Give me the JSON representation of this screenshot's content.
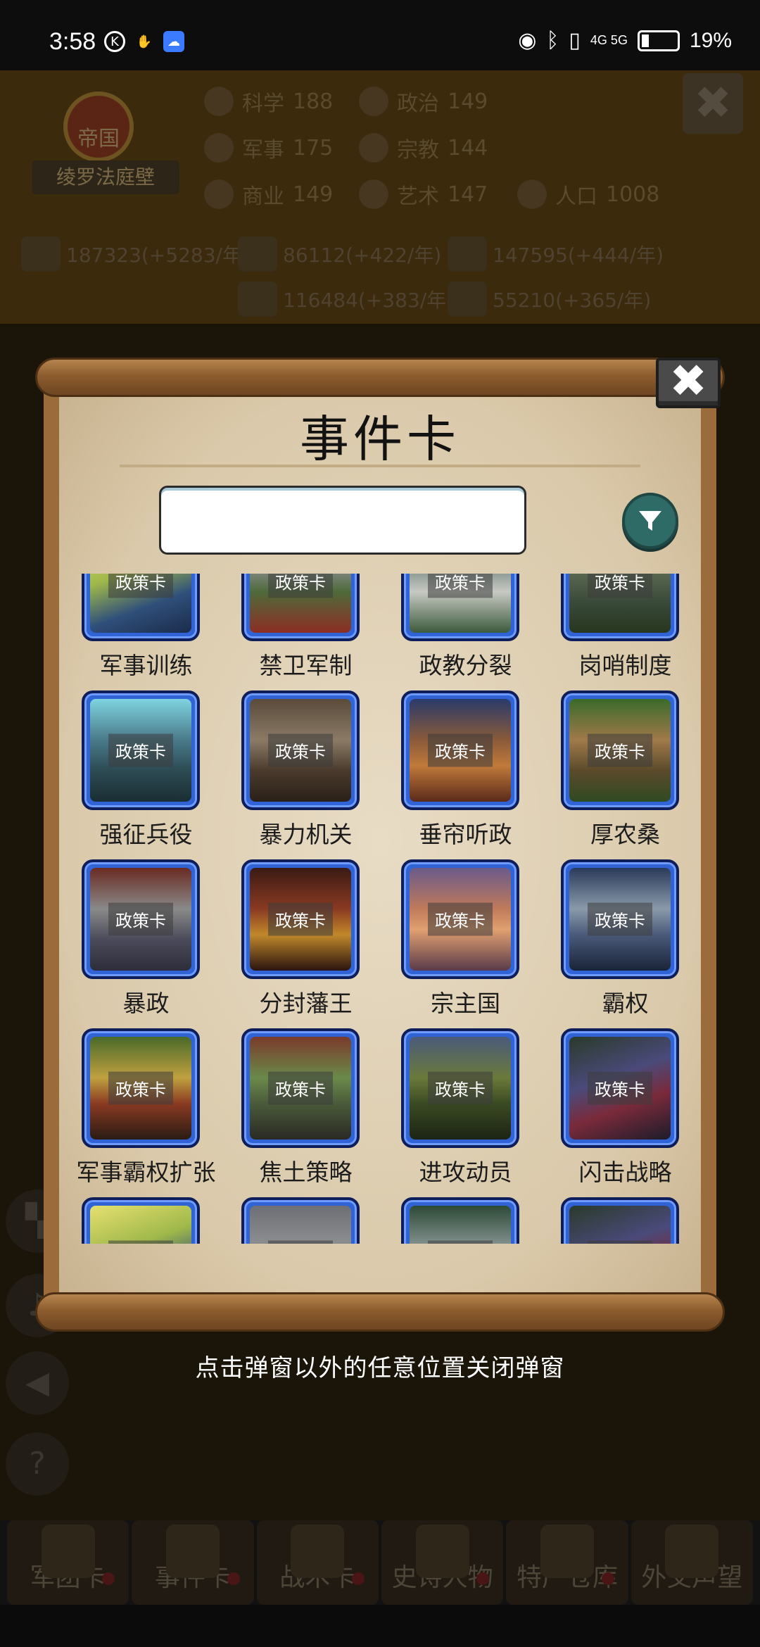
{
  "status_bar": {
    "time": "3:58",
    "network": "4G 5G",
    "battery": "19%"
  },
  "empire": {
    "title": "帝国",
    "name": "绫罗法庭壁"
  },
  "stats": [
    {
      "label": "科学",
      "value": "188",
      "icon": "science-icon"
    },
    {
      "label": "政治",
      "value": "149",
      "icon": "politics-icon"
    },
    {
      "label": "军事",
      "value": "175",
      "icon": "military-icon"
    },
    {
      "label": "宗教",
      "value": "144",
      "icon": "religion-icon"
    },
    {
      "label": "商业",
      "value": "149",
      "icon": "commerce-icon"
    },
    {
      "label": "艺术",
      "value": "147",
      "icon": "art-icon"
    },
    {
      "label": "人口",
      "value": "1008",
      "icon": "population-icon"
    }
  ],
  "resources": [
    {
      "text": "187323(+5283/年",
      "icon": "gold-icon"
    },
    {
      "text": "86112(+422/年)",
      "icon": "wood-icon"
    },
    {
      "text": "147595(+444/年)",
      "icon": "iron-icon"
    },
    {
      "text": "116484(+383/年)",
      "icon": "stone-icon"
    },
    {
      "text": "55210(+365/年)",
      "icon": "meat-icon"
    }
  ],
  "dialog": {
    "title": "事件卡",
    "search_placeholder": "",
    "close_symbol": "✖",
    "badge_label": "政策卡",
    "cards": [
      {
        "name": "军事训练",
        "art": "soldiers"
      },
      {
        "name": "禁卫军制",
        "art": "guard"
      },
      {
        "name": "政教分裂",
        "art": "temple"
      },
      {
        "name": "岗哨制度",
        "art": "sentry"
      },
      {
        "name": "强征兵役",
        "art": "conscription"
      },
      {
        "name": "暴力机关",
        "art": "violence"
      },
      {
        "name": "垂帘听政",
        "art": "regency"
      },
      {
        "name": "厚农桑",
        "art": "farm"
      },
      {
        "name": "暴政",
        "art": "tyranny"
      },
      {
        "name": "分封藩王",
        "art": "vassal"
      },
      {
        "name": "宗主国",
        "art": "suzerain"
      },
      {
        "name": "霸权",
        "art": "hegemony"
      },
      {
        "name": "军事霸权扩张",
        "art": "expansion"
      },
      {
        "name": "焦土策略",
        "art": "scorched"
      },
      {
        "name": "进攻动员",
        "art": "mobilize"
      },
      {
        "name": "闪击战略",
        "art": "blitz"
      },
      {
        "name": "",
        "art": "soldiers"
      },
      {
        "name": "",
        "art": "guard"
      },
      {
        "name": "",
        "art": "temple"
      },
      {
        "name": "",
        "art": "blitz"
      }
    ]
  },
  "hint": "点击弹窗以外的任意位置关闭弹窗",
  "bottom_nav": [
    "军团卡",
    "事件卡",
    "战术卡",
    "史诗人物",
    "特产仓库",
    "外交声望"
  ],
  "colors": {
    "card_border": "#2f63d6",
    "filter_button": "#2f6b66",
    "scroll_wood": "#9c6b3b",
    "paper": "#dccdb2"
  }
}
